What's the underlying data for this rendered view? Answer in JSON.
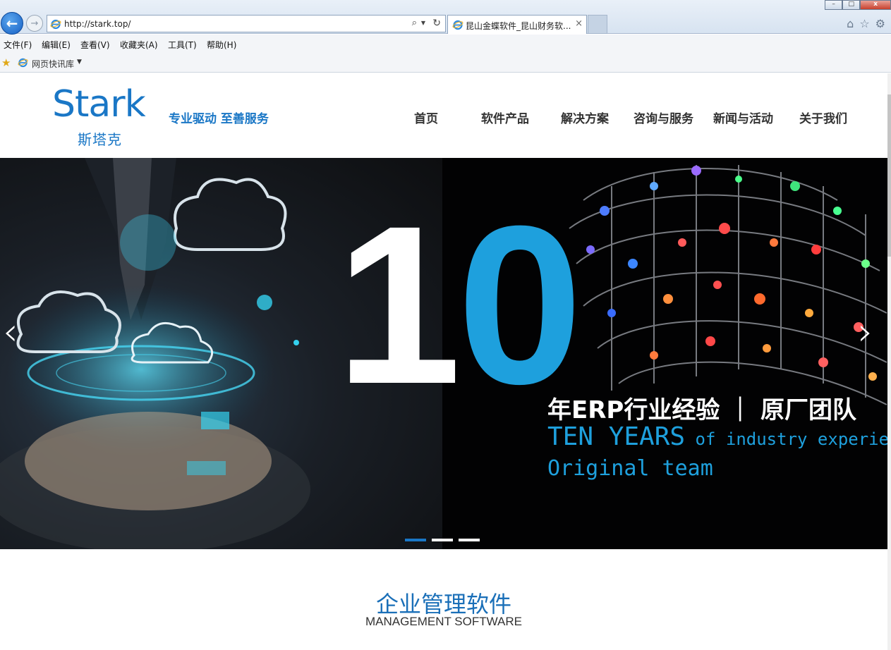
{
  "browser": {
    "url": "http://stark.top/",
    "tab_title": "昆山金蝶软件_昆山财务软...",
    "tab_close": "×",
    "back_glyph": "←",
    "forward_glyph": "→",
    "icons": [
      "ie-icon",
      "search-icon",
      "refresh-icon",
      "home-icon",
      "star-icon",
      "gear-icon"
    ],
    "menu": [
      "文件(F)",
      "编辑(E)",
      "查看(V)",
      "收藏夹(A)",
      "工具(T)",
      "帮助(H)"
    ],
    "favorites_bar": {
      "label": "网页快讯库"
    },
    "window_controls": {
      "minimize": "–",
      "maximize": "□",
      "close": "x"
    }
  },
  "site": {
    "logo_word": "Stark",
    "logo_cn": "斯塔克",
    "slogan": "专业驱动 至善服务",
    "brand_color": "#1a77c6",
    "nav": [
      "首页",
      "软件产品",
      "解决方案",
      "咨询与服务",
      "新闻与活动",
      "关于我们"
    ]
  },
  "hero": {
    "digit_one": "1",
    "digit_zero": "0",
    "line1": "年ERP行业经验 ｜ 原厂团队",
    "line2_big": "TEN YEARS",
    "line2_small": " of industry experience",
    "line3": "Original team",
    "prev_glyph": "‹",
    "next_glyph": "›",
    "slide_count": 3,
    "active_slide": 1,
    "accent_color": "#1ea0dd"
  },
  "section": {
    "title": "企业管理软件",
    "subtitle": "MANAGEMENT SOFTWARE"
  }
}
